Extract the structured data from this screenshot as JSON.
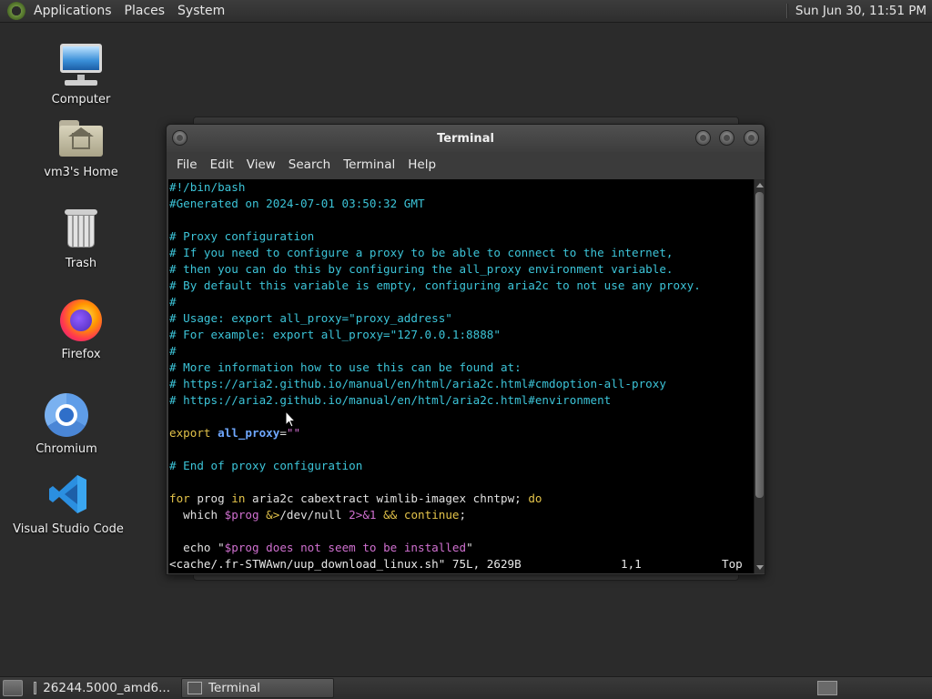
{
  "top_panel": {
    "menu": [
      "Applications",
      "Places",
      "System"
    ],
    "clock": "Sun Jun 30, 11:51 PM"
  },
  "desktop_icons": [
    {
      "label": "Computer",
      "icon": "computer-icon"
    },
    {
      "label": "vm3's Home",
      "icon": "home-folder-icon"
    },
    {
      "label": "Trash",
      "icon": "trash-icon"
    },
    {
      "label": "Firefox",
      "icon": "firefox-icon"
    },
    {
      "label": "Chromium",
      "icon": "chromium-icon"
    },
    {
      "label": "Visual Studio Code",
      "icon": "vscode-icon"
    }
  ],
  "terminal": {
    "title": "Terminal",
    "menu": [
      "File",
      "Edit",
      "View",
      "Search",
      "Terminal",
      "Help"
    ],
    "lines": [
      "#!/bin/bash",
      "#Generated on 2024-07-01 03:50:32 GMT",
      "",
      "# Proxy configuration",
      "# If you need to configure a proxy to be able to connect to the internet,",
      "# then you can do this by configuring the all_proxy environment variable.",
      "# By default this variable is empty, configuring aria2c to not use any proxy.",
      "#",
      "# Usage: export all_proxy=\"proxy_address\"",
      "# For example: export all_proxy=\"127.0.0.1:8888\"",
      "#",
      "# More information how to use this can be found at:",
      "# https://aria2.github.io/manual/en/html/aria2c.html#cmdoption-all-proxy",
      "# https://aria2.github.io/manual/en/html/aria2c.html#environment",
      "",
      "export all_proxy=\"\"",
      "",
      "# End of proxy configuration",
      "",
      "for prog in aria2c cabextract wimlib-imagex chntpw; do",
      "  which $prog &>/dev/null 2>&1 && continue;",
      "",
      "  echo \"$prog does not seem to be installed\""
    ],
    "status_file": "<cache/.fr-STWAwn/uup_download_linux.sh\" 75L, 2629B",
    "status_pos": "1,1",
    "status_scroll": "Top"
  },
  "taskbar": {
    "tasks": [
      {
        "label": "26244.5000_amd6...",
        "active": false
      },
      {
        "label": "Terminal",
        "active": true
      }
    ]
  },
  "colors": {
    "comment": "#3cc4d8",
    "keyword": "#e3c34a",
    "variable": "#6fa8ff",
    "string": "#d070d0"
  }
}
